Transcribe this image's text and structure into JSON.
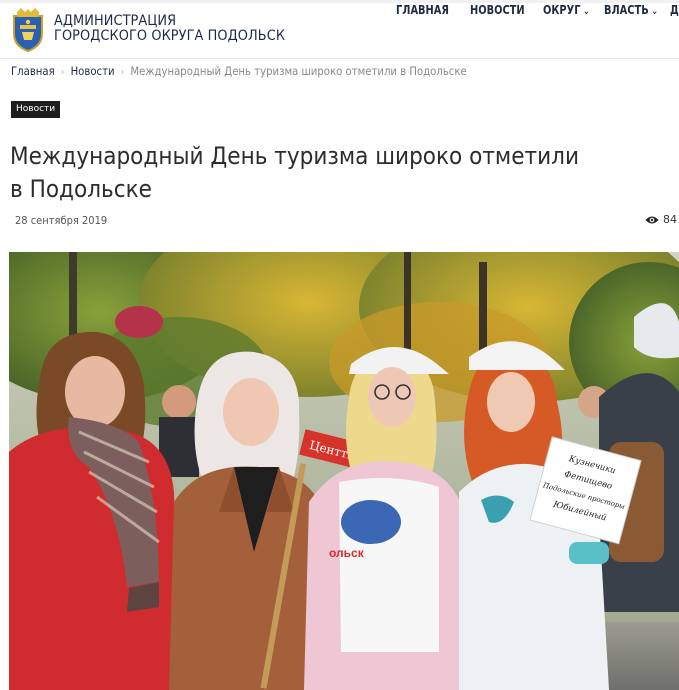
{
  "header": {
    "brand_line1": "АДМИНИСТРАЦИЯ",
    "brand_line2": "ГОРОДСКОГО ОКРУГА ПОДОЛЬСК",
    "nav": [
      {
        "label": "ГЛАВНАЯ"
      },
      {
        "label": "НОВОСТИ"
      },
      {
        "label": "ОКРУГ"
      },
      {
        "label": "ВЛАСТЬ"
      },
      {
        "label": "Д"
      }
    ]
  },
  "breadcrumb": {
    "home": "Главная",
    "section": "Новости",
    "current": "Международный День туризма широко отметили в Подольске"
  },
  "article": {
    "tag": "Новости",
    "title": "Международный День туризма широко отметили в Подольске",
    "date": "28 сентября 2019",
    "views": "84"
  },
  "photo": {
    "sign_text": "Центтики",
    "card_lines": [
      "Кузнечики",
      "Фетищево",
      "Подольские просторы",
      "Юбилейный"
    ],
    "shirt_text": "ольск"
  }
}
